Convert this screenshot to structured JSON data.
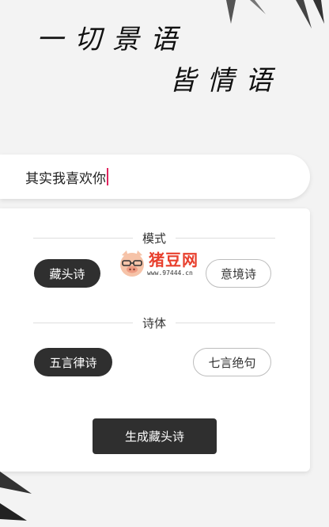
{
  "title": {
    "line1": "一切景语",
    "line2": "皆情语"
  },
  "input": {
    "value": "其实我喜欢你"
  },
  "mode_section": {
    "label": "模式",
    "options": [
      "藏头诗",
      "意境诗"
    ],
    "selected": "藏头诗"
  },
  "form_section": {
    "label": "诗体",
    "options": [
      "五言律诗",
      "七言绝句"
    ],
    "selected": "五言律诗"
  },
  "generate_button": {
    "label": "生成藏头诗"
  },
  "watermark": {
    "name": "猪豆网",
    "url": "www.97444.cn"
  },
  "colors": {
    "background": "#f3f3f3",
    "active_pill": "#2f2f2f",
    "caret": "#e0245e",
    "watermark": "#e8402e"
  }
}
